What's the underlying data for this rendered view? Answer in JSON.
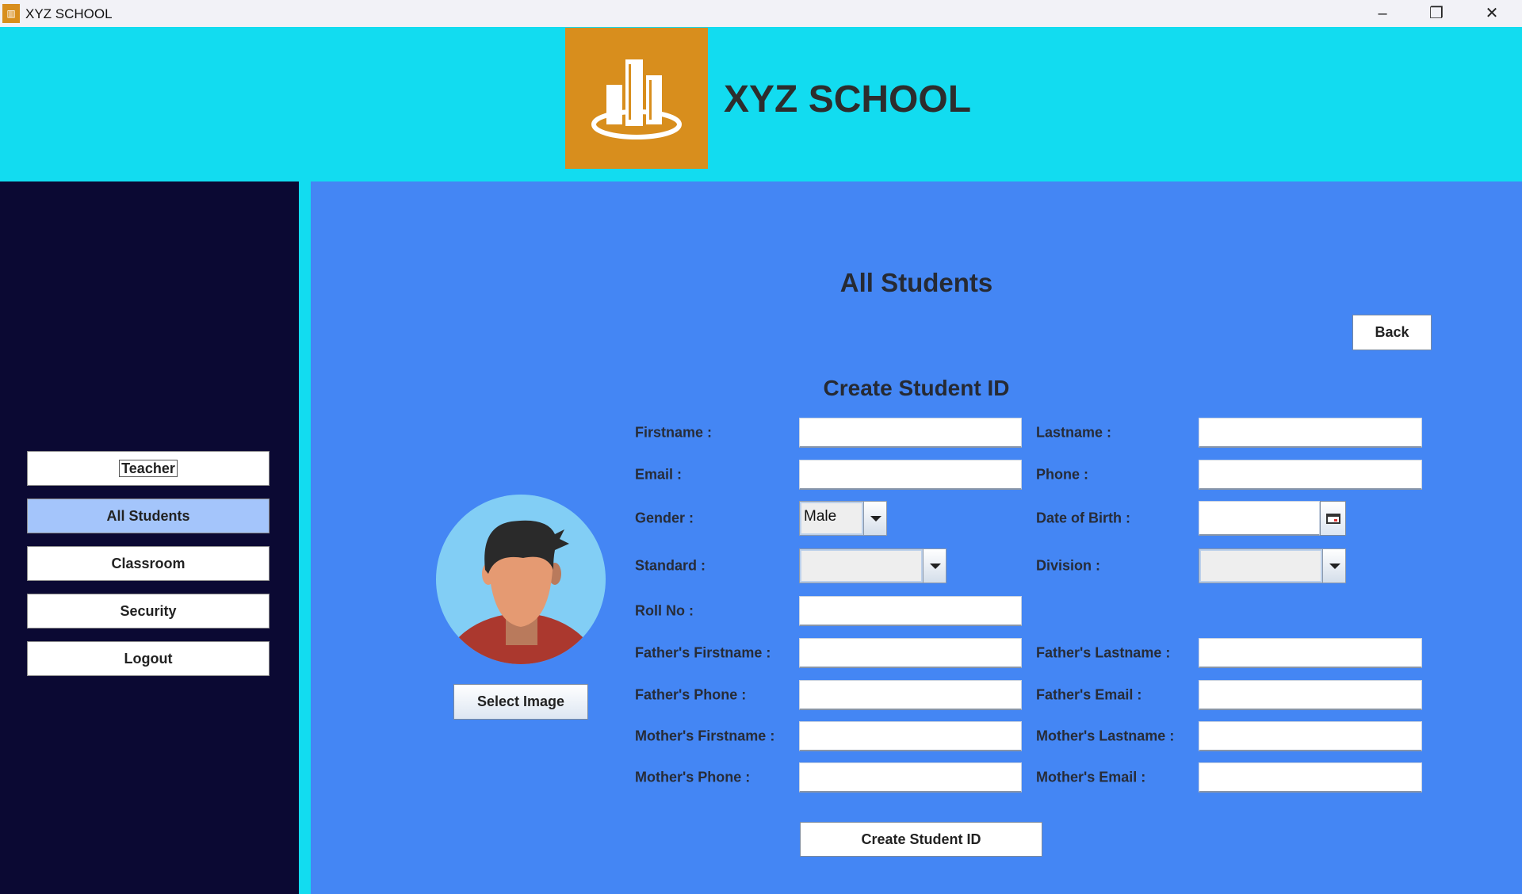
{
  "window": {
    "title": "XYZ SCHOOL",
    "controls": [
      "minimize",
      "restore",
      "close"
    ]
  },
  "header": {
    "app_name": "XYZ SCHOOL",
    "logo": "city-buildings-logo"
  },
  "sidebar": {
    "items": [
      {
        "label": "Teacher"
      },
      {
        "label": "All Students",
        "active": true
      },
      {
        "label": "Classroom"
      },
      {
        "label": "Security"
      },
      {
        "label": "Logout"
      }
    ]
  },
  "main": {
    "title": "All Students",
    "back_label": "Back",
    "form_title": "Create Student ID",
    "select_image_label": "Select Image",
    "submit_label": "Create Student ID",
    "fields": {
      "firstname": {
        "label": "Firstname :",
        "value": ""
      },
      "lastname": {
        "label": "Lastname :",
        "value": ""
      },
      "email": {
        "label": "Email :",
        "value": ""
      },
      "phone": {
        "label": "Phone :",
        "value": ""
      },
      "gender": {
        "label": "Gender :",
        "value": "Male"
      },
      "dob": {
        "label": "Date of Birth :",
        "value": ""
      },
      "standard": {
        "label": "Standard :",
        "value": ""
      },
      "division": {
        "label": "Division :",
        "value": ""
      },
      "rollno": {
        "label": "Roll No :",
        "value": ""
      },
      "father_first": {
        "label": "Father's Firstname :",
        "value": ""
      },
      "father_last": {
        "label": "Father's Lastname :",
        "value": ""
      },
      "father_phone": {
        "label": "Father's Phone :",
        "value": ""
      },
      "father_email": {
        "label": "Father's Email :",
        "value": ""
      },
      "mother_first": {
        "label": "Mother's Firstname :",
        "value": ""
      },
      "mother_last": {
        "label": "Mother's Lastname :",
        "value": ""
      },
      "mother_phone": {
        "label": "Mother's Phone :",
        "value": ""
      },
      "mother_email": {
        "label": "Mother's Email :",
        "value": ""
      }
    }
  },
  "colors": {
    "header": "#12dcf0",
    "sidebar": "#0b0933",
    "main": "#4486f4",
    "logo": "#d88e1d",
    "active_nav": "#a4c5fb"
  }
}
